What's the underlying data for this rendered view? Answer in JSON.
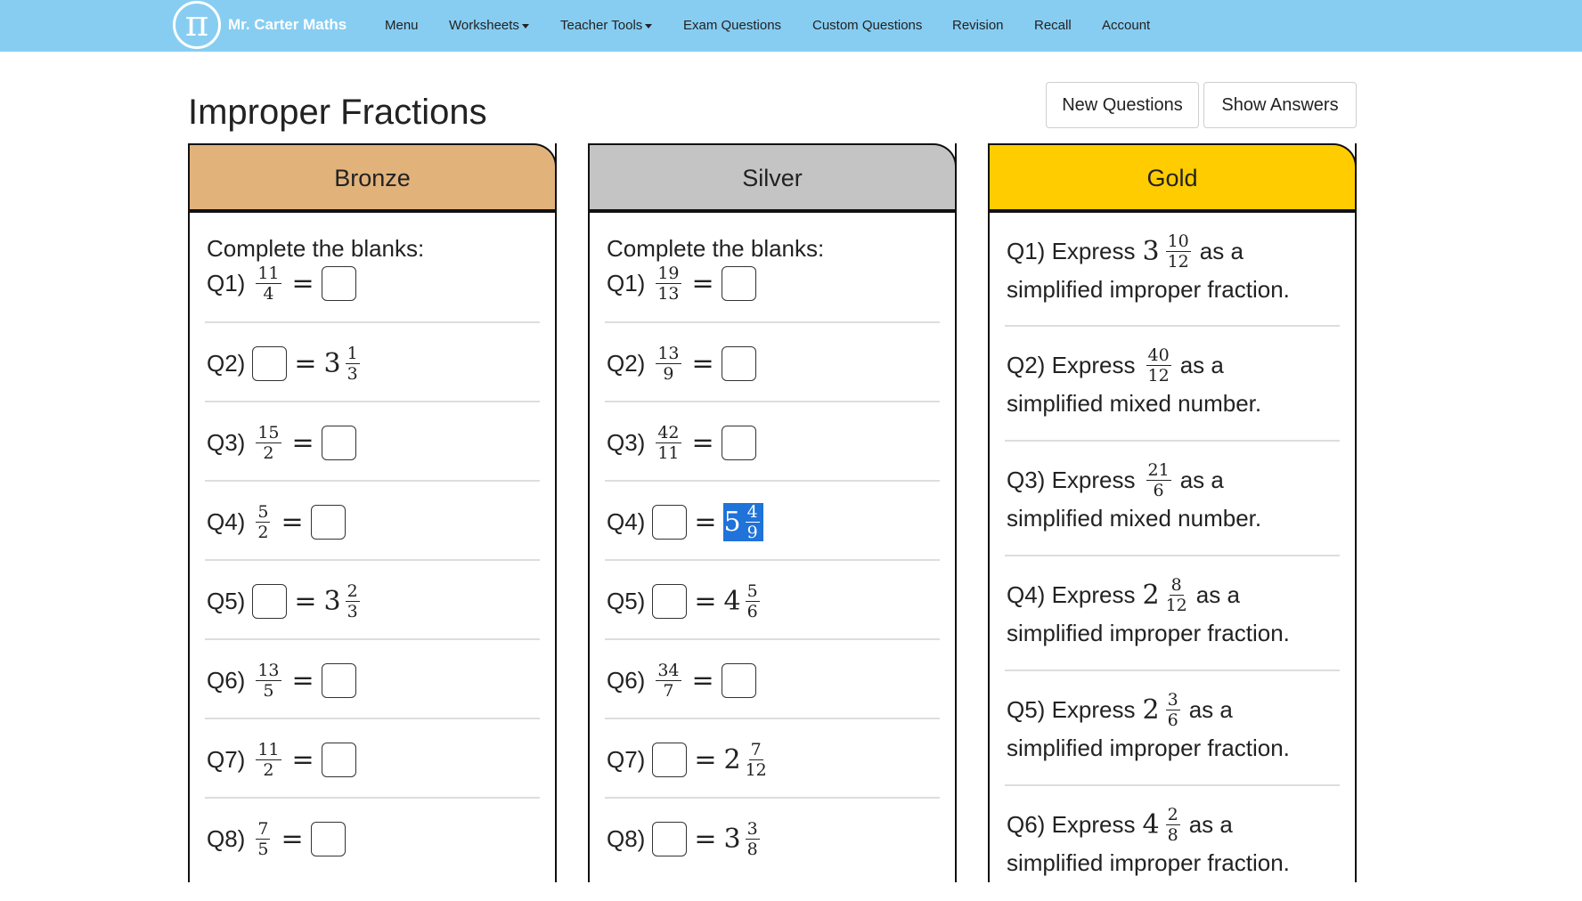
{
  "nav": {
    "logo_symbol": "π",
    "logo_text": "Mr. Carter Maths",
    "items": [
      "Menu",
      "Worksheets",
      "Teacher Tools",
      "Exam Questions",
      "Custom Questions",
      "Revision",
      "Recall",
      "Account"
    ]
  },
  "page": {
    "title": "Improper Fractions",
    "new_questions": "New Questions",
    "show_answers": "Show Answers"
  },
  "bronze": {
    "title": "Bronze",
    "prompt": "Complete the blanks:",
    "questions": [
      {
        "label": "Q1)",
        "num": "11",
        "den": "4"
      },
      {
        "label": "Q2)",
        "whole": "3",
        "num": "1",
        "den": "3"
      },
      {
        "label": "Q3)",
        "num": "15",
        "den": "2"
      },
      {
        "label": "Q4)",
        "num": "5",
        "den": "2"
      },
      {
        "label": "Q5)",
        "whole": "3",
        "num": "2",
        "den": "3"
      },
      {
        "label": "Q6)",
        "num": "13",
        "den": "5"
      },
      {
        "label": "Q7)",
        "num": "11",
        "den": "2"
      },
      {
        "label": "Q8)",
        "num": "7",
        "den": "5"
      }
    ]
  },
  "silver": {
    "title": "Silver",
    "prompt": "Complete the blanks:",
    "questions": [
      {
        "label": "Q1)",
        "num": "19",
        "den": "13"
      },
      {
        "label": "Q2)",
        "num": "13",
        "den": "9"
      },
      {
        "label": "Q3)",
        "num": "42",
        "den": "11"
      },
      {
        "label": "Q4)",
        "whole": "5",
        "num": "4",
        "den": "9"
      },
      {
        "label": "Q5)",
        "whole": "4",
        "num": "5",
        "den": "6"
      },
      {
        "label": "Q6)",
        "num": "34",
        "den": "7"
      },
      {
        "label": "Q7)",
        "whole": "2",
        "num": "7",
        "den": "12"
      },
      {
        "label": "Q8)",
        "whole": "3",
        "num": "3",
        "den": "8"
      }
    ]
  },
  "gold": {
    "title": "Gold",
    "questions": [
      {
        "label": "Q1) Express",
        "whole": "3",
        "num": "10",
        "den": "12",
        "tail": "as a",
        "line2": "simplified improper fraction."
      },
      {
        "label": "Q2) Express",
        "num": "40",
        "den": "12",
        "tail": "as a",
        "line2": "simplified mixed number."
      },
      {
        "label": "Q3) Express",
        "num": "21",
        "den": "6",
        "tail": "as a",
        "line2": "simplified mixed number."
      },
      {
        "label": "Q4) Express",
        "whole": "2",
        "num": "8",
        "den": "12",
        "tail": "as a",
        "line2": "simplified improper fraction."
      },
      {
        "label": "Q5) Express",
        "whole": "2",
        "num": "3",
        "den": "6",
        "tail": "as a",
        "line2": "simplified improper fraction."
      },
      {
        "label": "Q6) Express",
        "whole": "4",
        "num": "2",
        "den": "8",
        "tail": "as a",
        "line2": "simplified improper fraction."
      }
    ]
  },
  "colors": {
    "nav_bg": "#87cdf2",
    "bronze": "#e1b37b",
    "silver": "#c4c4c4",
    "gold": "#ffcc00",
    "selection": "#1f73d9"
  },
  "icons": {
    "caret": "caret-down-icon",
    "logo": "pi-logo-icon"
  }
}
